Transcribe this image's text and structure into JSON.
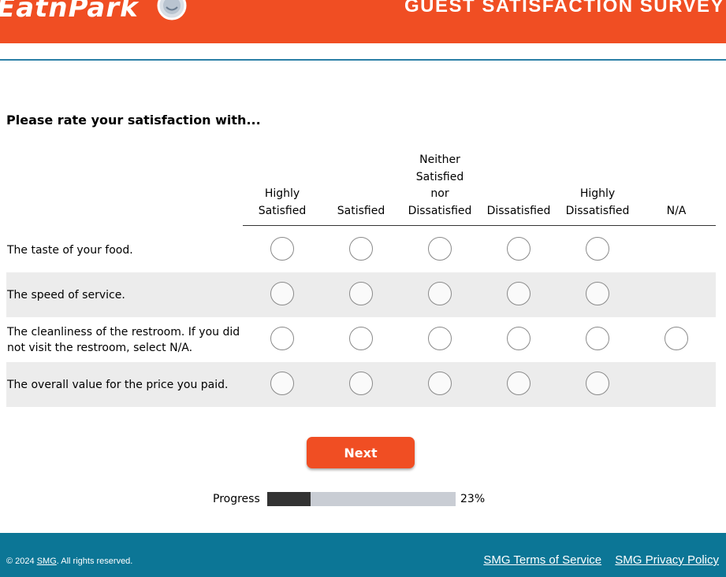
{
  "header": {
    "logo_text": "EatnPark",
    "logo_icon": "smiley-cookie-icon",
    "survey_title": "GUEST SATISFACTION SURVEY",
    "brand_color": "#f04e23"
  },
  "question": {
    "prompt": "Please rate your satisfaction with..."
  },
  "columns": [
    {
      "lines": [
        "",
        "",
        "Highly",
        "Satisfied"
      ]
    },
    {
      "lines": [
        "",
        "",
        "",
        "Satisfied"
      ]
    },
    {
      "lines": [
        "Neither",
        "Satisfied",
        "nor",
        "Dissatisfied"
      ]
    },
    {
      "lines": [
        "",
        "",
        "",
        "Dissatisfied"
      ]
    },
    {
      "lines": [
        "",
        "",
        "Highly",
        "Dissatisfied"
      ]
    },
    {
      "lines": [
        "",
        "",
        "",
        "N/A"
      ]
    }
  ],
  "rows": [
    {
      "label": "The taste of your food.",
      "has_na": false
    },
    {
      "label": "The speed of service.",
      "has_na": false
    },
    {
      "label": "The cleanliness of the restroom. If you did not visit the restroom, select N/A.",
      "has_na": true
    },
    {
      "label": "The overall value for the price you paid.",
      "has_na": false
    }
  ],
  "next_button": {
    "label": "Next"
  },
  "progress": {
    "label": "Progress",
    "percent_text": "23%",
    "value": 0.23
  },
  "footer": {
    "copyright_prefix": "© 2024",
    "copyright_link": "SMG",
    "copyright_suffix": ". All rights reserved.",
    "terms_link": "SMG Terms of Service",
    "privacy_link": "SMG Privacy Policy",
    "footer_color": "#0c7696"
  }
}
